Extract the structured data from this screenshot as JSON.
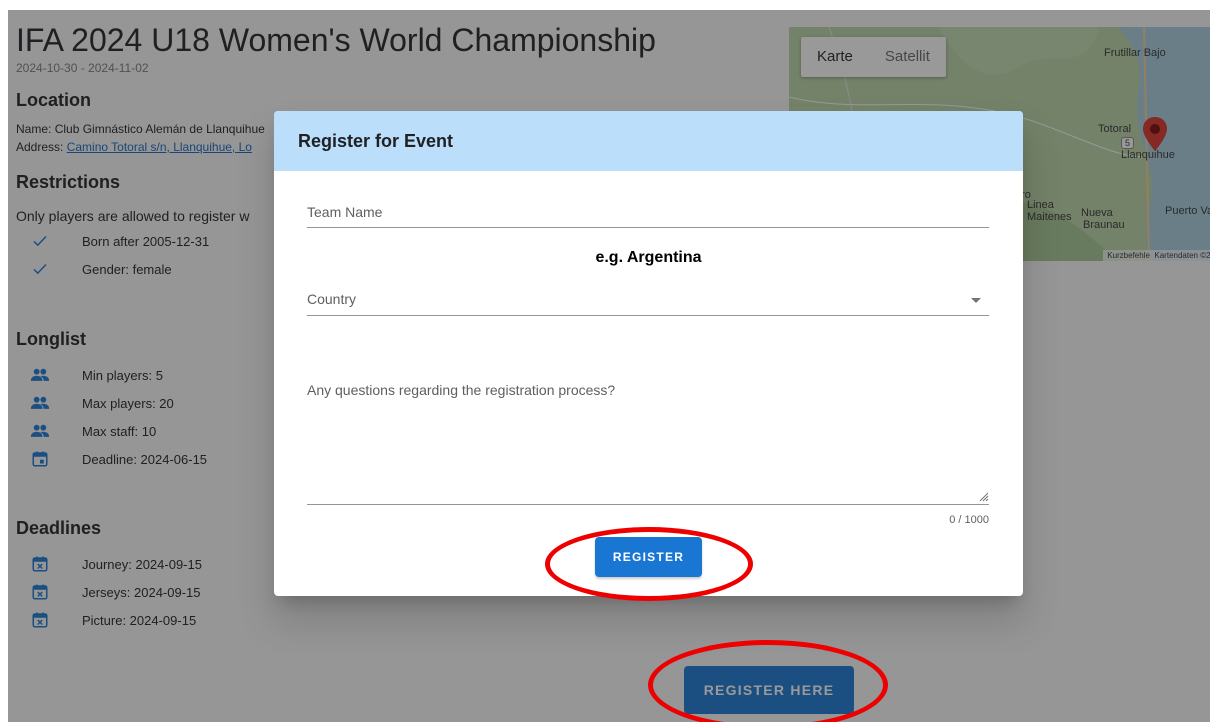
{
  "event": {
    "title": "IFA 2024 U18 Women's World Championship",
    "dates": "2024-10-30 - 2024-11-02"
  },
  "location": {
    "heading": "Location",
    "name_label": "Name: ",
    "name_value": "Club Gimnástico Alemán de Llanquihue",
    "address_label": "Address: ",
    "address_value": "Camino Totoral s/n, Llanquihue, Lo"
  },
  "restrictions": {
    "heading": "Restrictions",
    "text": "Only players are allowed to register w",
    "items": [
      {
        "label": "Born after 2005-12-31",
        "icon": "check-icon"
      },
      {
        "label": "Gender: female",
        "icon": "check-icon"
      }
    ]
  },
  "longlist": {
    "heading": "Longlist",
    "items": [
      {
        "label": "Min players: 5",
        "icon": "people-icon"
      },
      {
        "label": "Max players: 20",
        "icon": "people-icon"
      },
      {
        "label": "Max staff: 10",
        "icon": "people-icon"
      },
      {
        "label": "Deadline: 2024-06-15",
        "icon": "calendar-icon"
      }
    ]
  },
  "deadlines": {
    "heading": "Deadlines",
    "items": [
      {
        "label": "Journey: 2024-09-15",
        "icon": "calendar-x-icon"
      },
      {
        "label": "Jerseys: 2024-09-15",
        "icon": "calendar-x-icon"
      },
      {
        "label": "Picture: 2024-09-15",
        "icon": "calendar-x-icon"
      }
    ]
  },
  "map": {
    "tab_map": "Karte",
    "tab_satellite": "Satellit",
    "places": {
      "frutillar": "Frutillar Bajo",
      "totoral": "Totoral",
      "llanquihue": "Llanquihue",
      "nueva": "Nueva",
      "braunau": "Braunau",
      "puerto_varas": "Puerto Varas",
      "linea": "Linea",
      "maitenes": "Maitenes",
      "oro": "oro",
      "route": "5"
    },
    "shortcuts": "Kurzbefehle",
    "map_data": "Kartendaten ©20"
  },
  "register_here_label": "Register here",
  "dialog": {
    "title": "Register for Event",
    "team_name_label": "Team Name",
    "team_hint": "e.g. Argentina",
    "country_label": "Country",
    "questions_label": "Any questions regarding the registration process?",
    "counter": "0 / 1000",
    "register_label": "Register"
  },
  "colors": {
    "primary": "#1976d2",
    "dialog_header": "#bbdefb",
    "annotation": "#ee0000",
    "link": "#1565c0"
  }
}
